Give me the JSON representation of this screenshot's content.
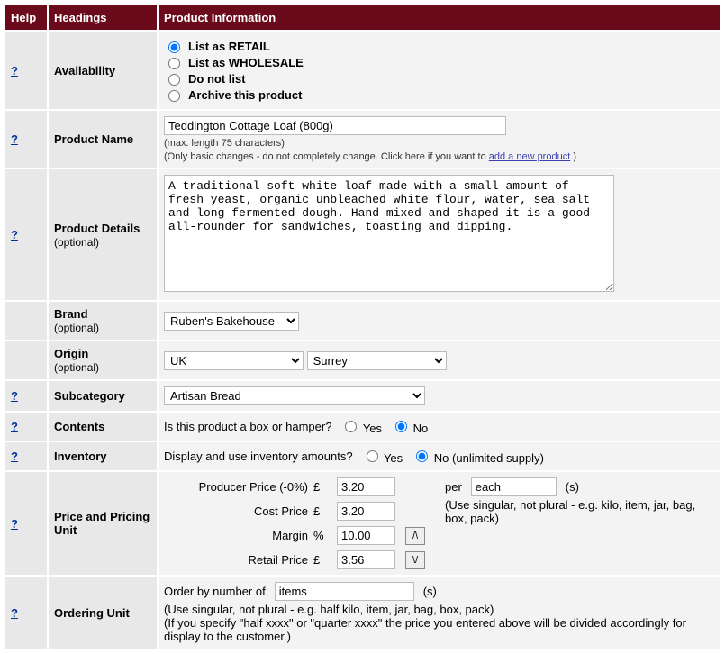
{
  "headers": {
    "help": "Help",
    "headings": "Headings",
    "product_info": "Product Information"
  },
  "help_q": "?",
  "availability": {
    "heading": "Availability",
    "retail": "List as RETAIL",
    "wholesale": "List as WHOLESALE",
    "donotlist": "Do not list",
    "archive": "Archive this product",
    "selected": "retail"
  },
  "product_name": {
    "heading": "Product Name",
    "value": "Teddington Cottage Loaf (800g)",
    "hint1": "(max. length 75 characters)",
    "hint2_a": "(Only basic changes - do not completely change. Click here if you want to ",
    "hint2_link": "add a new product",
    "hint2_b": ".)"
  },
  "product_details": {
    "heading": "Product Details",
    "optional": "(optional)",
    "value": "A traditional soft white loaf made with a small amount of fresh yeast, organic unbleached white flour, water, sea salt and long fermented dough. Hand mixed and shaped it is a good all-rounder for sandwiches, toasting and dipping."
  },
  "brand": {
    "heading": "Brand",
    "optional": "(optional)",
    "value": "Ruben's Bakehouse"
  },
  "origin": {
    "heading": "Origin",
    "optional": "(optional)",
    "country": "UK",
    "region": "Surrey"
  },
  "subcategory": {
    "heading": "Subcategory",
    "value": "Artisan Bread"
  },
  "contents": {
    "heading": "Contents",
    "label": "Is this product a box or hamper?",
    "yes": "Yes",
    "no": "No",
    "selected": "no"
  },
  "inventory": {
    "heading": "Inventory",
    "label": "Display and use inventory amounts?",
    "yes": "Yes",
    "no_text": "No (unlimited supply)",
    "selected": "no"
  },
  "pricing": {
    "heading": "Price and Pricing Unit",
    "producer_label": "Producer Price (-0%)",
    "currency": "£",
    "producer_value": "3.20",
    "cost_label": "Cost Price",
    "cost_value": "3.20",
    "margin_label": "Margin",
    "percent": "%",
    "margin_value": "10.00",
    "retail_label": "Retail Price",
    "retail_value": "3.56",
    "per_prefix": "per",
    "per_value": "each",
    "per_suffix": "(s)",
    "per_hint": "(Use singular, not plural - e.g. kilo, item, jar, bag, box, pack)",
    "up": "/\\",
    "down": "\\/"
  },
  "ordering": {
    "heading": "Ordering Unit",
    "prefix": "Order by number of",
    "value": "items",
    "suffix": "(s)",
    "hint1": "(Use singular, not plural - e.g. half kilo, item, jar, bag, box, pack)",
    "hint2": "(If you specify \"half xxxx\" or \"quarter xxxx\" the price you entered above will be divided accordingly for display to the customer.)"
  }
}
